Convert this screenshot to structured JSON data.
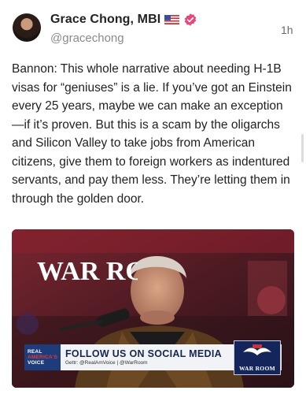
{
  "post": {
    "author": {
      "name": "Grace Chong, MBI",
      "handle": "@gracechong",
      "flag_icon": "us-flag-icon",
      "verified_icon": "verified-badge-icon",
      "verified_color": "#e8457b"
    },
    "timestamp": "1h",
    "body": "Bannon: This whole narrative about needing H-1B visas for “geniuses” is a lie. If you’ve got an Einstein every 25 years, maybe we can make an exception—if it’s proven. But this is a scam by the oligarchs and Silicon Valley to take jobs from American citizens, give them to foreign workers as indentured servants, and pay them less. They’re letting them in through the golden door."
  },
  "media": {
    "studio_sign": "WAR ROOM",
    "lower_third": {
      "network_logo_line1": "REAL",
      "network_logo_line2": "AMERICA'S",
      "network_logo_line3": "VOICE",
      "title": "FOLLOW US ON SOCIAL MEDIA",
      "subtitle": "Gettr: @RealAmVoice | @WarRoom"
    },
    "badge": "WAR ROOM"
  }
}
